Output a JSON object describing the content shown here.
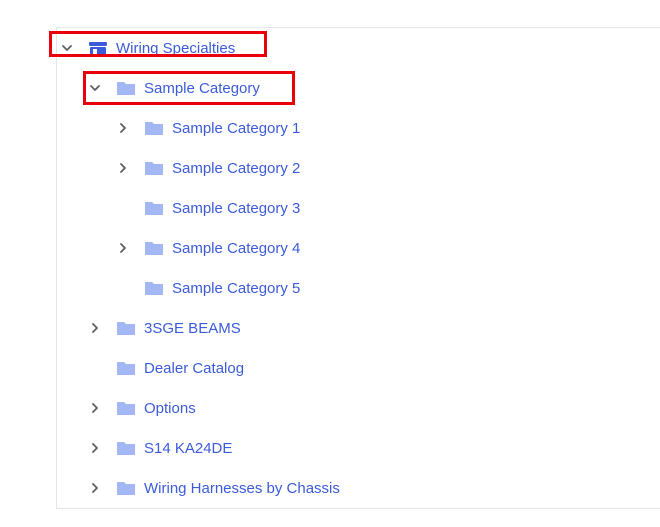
{
  "tree": {
    "root": {
      "label": "Wiring Specialties",
      "expanded": true,
      "icon": "store-icon"
    },
    "category": {
      "label": "Sample Category",
      "expanded": true
    },
    "subcategories": [
      {
        "label": "Sample Category 1",
        "has_children": true
      },
      {
        "label": "Sample Category 2",
        "has_children": true
      },
      {
        "label": "Sample Category 3",
        "has_children": false
      },
      {
        "label": "Sample Category 4",
        "has_children": true
      },
      {
        "label": "Sample Category 5",
        "has_children": false
      }
    ],
    "siblings": [
      {
        "label": "3SGE BEAMS",
        "has_children": true
      },
      {
        "label": "Dealer Catalog",
        "has_children": false
      },
      {
        "label": "Options",
        "has_children": true
      },
      {
        "label": "S14 KA24DE",
        "has_children": true
      },
      {
        "label": "Wiring Harnesses by Chassis",
        "has_children": true
      }
    ]
  },
  "colors": {
    "link": "#3b5bdb",
    "folder": "#a3b7f5",
    "chevron": "#5a5f66",
    "highlight": "#e8000b"
  }
}
